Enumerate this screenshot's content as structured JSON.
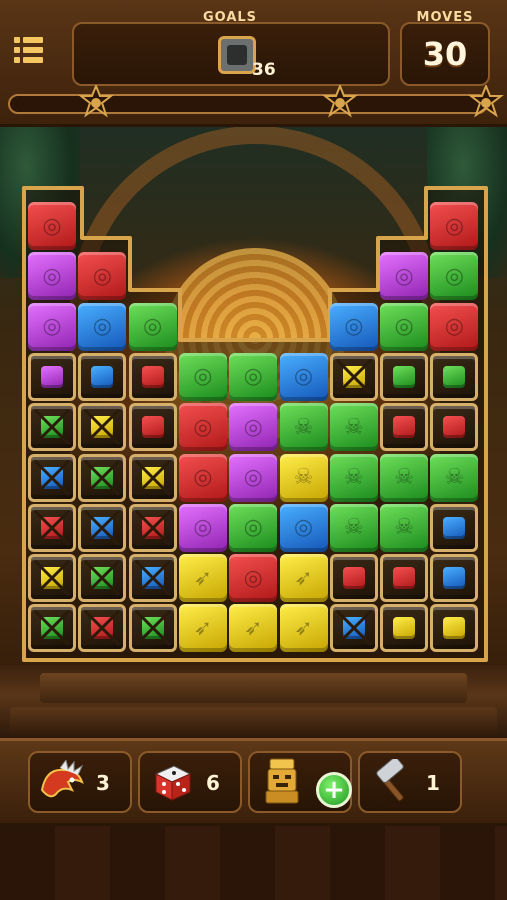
{
  "header": {
    "goals_label": "GOALS",
    "goal_count": "36",
    "goal_icon": "stone-block-icon",
    "moves_label": "MOVES",
    "moves_value": "30",
    "progress": 0,
    "menu_icon": "menu-list-icon"
  },
  "board": {
    "columns": 9,
    "rows": 9,
    "grid": [
      [
        "red",
        "",
        "",
        "",
        "",
        "",
        "",
        "",
        "red"
      ],
      [
        "purple",
        "red",
        "",
        "",
        "",
        "",
        "",
        "purple",
        "green"
      ],
      [
        "purple",
        "blue",
        "green",
        "",
        "",
        "",
        "blue",
        "green",
        "red"
      ],
      [
        "c:purple",
        "c:blue",
        "c:red",
        "green",
        "green",
        "blue",
        "x:yellow",
        "c:green",
        "c:green"
      ],
      [
        "x:green",
        "x:yellow",
        "c:red",
        "red",
        "purple",
        "skull:green",
        "skull:green",
        "c:red",
        "c:red"
      ],
      [
        "x:blue",
        "x:green",
        "x:yellow",
        "red",
        "purple",
        "skull:yellow",
        "skull:green",
        "skull:green",
        "skull:green"
      ],
      [
        "x:red",
        "x:blue",
        "x:red",
        "purple",
        "green",
        "blue",
        "skull:green",
        "skull:green",
        "c:blue"
      ],
      [
        "x:yellow",
        "x:green",
        "x:blue",
        "arrow:yellow",
        "red",
        "arrow:yellow",
        "c:red",
        "c:red",
        "c:blue"
      ],
      [
        "x:green",
        "x:red",
        "x:green",
        "arrow:yellow",
        "arrow:yellow",
        "arrow:yellow",
        "x:blue",
        "c:yellow",
        "c:yellow"
      ]
    ]
  },
  "boosters": [
    {
      "name": "quetzal-dragon-booster",
      "icon": "feathered-serpent-icon",
      "count": "3"
    },
    {
      "name": "dice-booster",
      "icon": "dice-icon",
      "count": "6"
    },
    {
      "name": "idol-booster",
      "icon": "golden-idol-icon",
      "count": ""
    },
    {
      "name": "hammer-booster",
      "icon": "hammer-icon",
      "count": "1"
    }
  ],
  "add_button_label": "+",
  "colors": {
    "frame_gold": "#d6b06a",
    "panel_brown": "#3a1f0a"
  }
}
